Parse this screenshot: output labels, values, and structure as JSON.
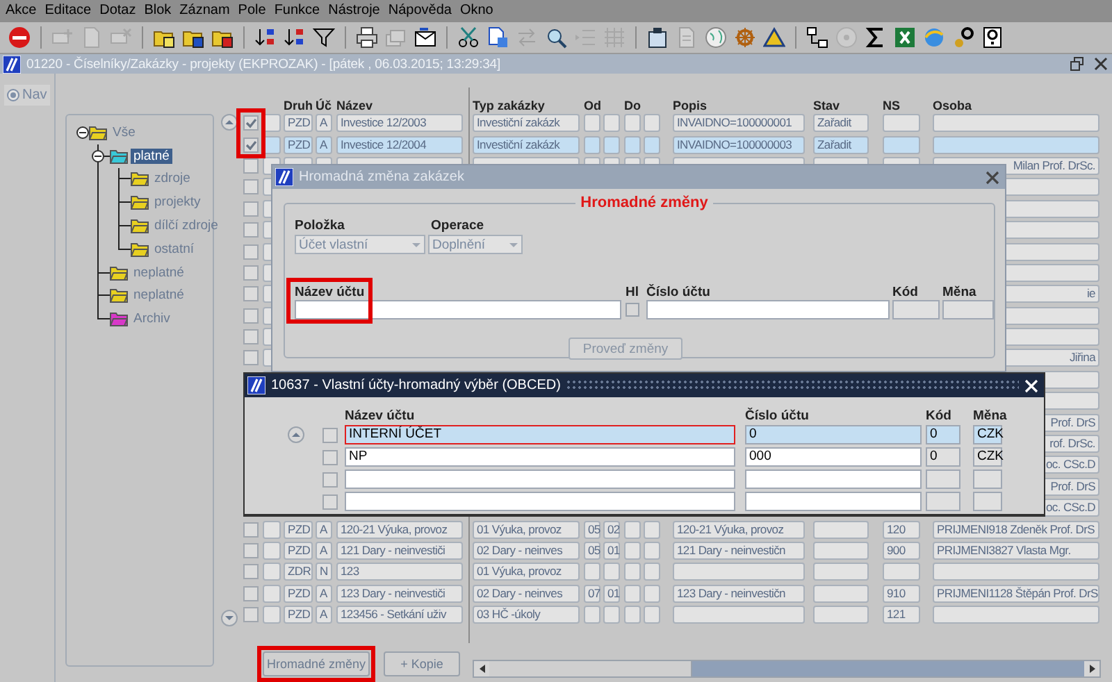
{
  "menu": [
    "Akce",
    "Editace",
    "Dotaz",
    "Blok",
    "Záznam",
    "Pole",
    "Funkce",
    "Nástroje",
    "Nápověda",
    "Okno"
  ],
  "toolbar": [
    {
      "disabled": false
    },
    {
      "disabled": true
    },
    {
      "disabled": true
    },
    {
      "disabled": true
    },
    {
      "disabled": false
    },
    {
      "disabled": false
    },
    {
      "disabled": false
    },
    {
      "disabled": false
    },
    {
      "disabled": false
    },
    {
      "disabled": false
    },
    {
      "disabled": false
    },
    {
      "disabled": true
    },
    {
      "disabled": false
    },
    {
      "disabled": false
    },
    {
      "disabled": false
    },
    {
      "disabled": true
    },
    {
      "disabled": false
    },
    {
      "disabled": true
    },
    {
      "disabled": true
    },
    {
      "disabled": false
    },
    {
      "disabled": true
    },
    {
      "disabled": false
    },
    {
      "disabled": false
    },
    {
      "disabled": false
    },
    {
      "disabled": false
    },
    {
      "disabled": true
    },
    {
      "disabled": false
    },
    {
      "disabled": false
    },
    {
      "disabled": false
    },
    {
      "disabled": false
    },
    {
      "disabled": false
    }
  ],
  "window": {
    "title": "01220 - Číselníky/Zakázky - projekty (EKPROZAK) - [pátek , 06.03.2015; 13:29:34]"
  },
  "nav": {
    "label": "Nav"
  },
  "tree": [
    {
      "label": "Vše",
      "expanded": true,
      "selected": false,
      "color": "#e8d020",
      "children": [
        {
          "label": "platné",
          "expanded": true,
          "selected": true,
          "color": "#38c8d8",
          "children": [
            {
              "label": "zdroje",
              "selected": false,
              "color": "#e8d020"
            },
            {
              "label": "projekty",
              "selected": false,
              "color": "#e8d020"
            },
            {
              "label": "dílčí zdroje",
              "selected": false,
              "color": "#e8d020"
            },
            {
              "label": "ostatní",
              "selected": false,
              "color": "#e8d020"
            }
          ]
        },
        {
          "label": "neplatné",
          "selected": false,
          "color": "#e8d020"
        },
        {
          "label": "neplatné",
          "selected": false,
          "color": "#e8d020"
        },
        {
          "label": "Archiv",
          "selected": false,
          "color": "#d838c8"
        }
      ]
    }
  ],
  "grid": {
    "columns": [
      "Druh",
      "Úč",
      "Název",
      "Typ zakázky",
      "Od",
      "Do",
      "Popis",
      "Stav",
      "NS",
      "Osoba"
    ],
    "rows": [
      {
        "kind": "full",
        "checked": true,
        "selected": false,
        "highlighted": true,
        "druh": "PZD",
        "uc": "A",
        "nazev": "Investice 12/2003",
        "typ": "Investiční zakázk",
        "popis": "INVAIDNO=100000001",
        "stav": "Zařadit"
      },
      {
        "kind": "full",
        "checked": true,
        "selected": true,
        "highlighted": true,
        "druh": "PZD",
        "uc": "A",
        "nazev": "Investice 12/2004",
        "typ": "Investiční zakázk",
        "popis": "INVAIDNO=100000003",
        "stav": "Zařadit"
      },
      {
        "kind": "tail",
        "checked": false,
        "osoba": "Milan Prof. DrSc."
      },
      {
        "kind": "tail",
        "checked": false
      },
      {
        "kind": "tail",
        "checked": false
      },
      {
        "kind": "tail",
        "checked": false
      },
      {
        "kind": "tail",
        "checked": false
      },
      {
        "kind": "tail",
        "checked": false
      },
      {
        "kind": "tail",
        "checked": false,
        "osoba": "ie"
      },
      {
        "kind": "tail",
        "checked": false
      },
      {
        "kind": "tail",
        "checked": false
      },
      {
        "kind": "tail",
        "checked": false,
        "osoba": "Jiřina"
      },
      {
        "kind": "tail"
      },
      {
        "kind": "tail"
      },
      {
        "kind": "tail",
        "osoba": "Prof. DrS"
      },
      {
        "kind": "tail",
        "osoba": "rof. DrSc."
      },
      {
        "kind": "tail",
        "osoba": "oc. CSc.D"
      },
      {
        "kind": "tail",
        "osoba": "Prof. DrS"
      },
      {
        "kind": "tail",
        "osoba": "oc. CSc.D"
      },
      {
        "kind": "full",
        "checked": false,
        "selected": false,
        "druh": "PZD",
        "uc": "A",
        "nazev": "120-21 Výuka, provoz",
        "typ": "01 Výuka, provoz",
        "od_1": "05",
        "od_2": "02",
        "popis": "120-21 Výuka, provoz",
        "ns": "120",
        "osoba": "PRIJMENI918 Zdeněk Prof. DrS"
      },
      {
        "kind": "full",
        "checked": false,
        "selected": false,
        "druh": "PZD",
        "uc": "A",
        "nazev": "121 Dary - neinvestiči",
        "typ": "02 Dary - neinves",
        "od_1": "05",
        "od_2": "01",
        "popis": "121 Dary - neinvestičn",
        "ns": "900",
        "osoba": "PRIJMENI3827 Vlasta Mgr."
      },
      {
        "kind": "full",
        "checked": false,
        "selected": false,
        "druh": "ZDR",
        "uc": "N",
        "nazev": "123",
        "typ": "01 Výuka, provoz"
      },
      {
        "kind": "full",
        "checked": false,
        "selected": false,
        "druh": "PZD",
        "uc": "A",
        "nazev": "123 Dary - neinvestiči",
        "typ": "02 Dary - neinves",
        "od_1": "07",
        "od_2": "01",
        "popis": "123 Dary - neinvestičn",
        "ns": "910",
        "osoba": "PRIJMENI1128 Štěpán Prof. DrS"
      },
      {
        "kind": "full",
        "checked": false,
        "selected": false,
        "druh": "PZD",
        "uc": "A",
        "nazev": "123456 - Setkání uživ",
        "typ": "03 HČ -úkoly",
        "ns": "121"
      }
    ]
  },
  "buttons": [
    {
      "label": "Hromadné změny",
      "highlighted": true
    },
    {
      "label": "+ Kopie"
    }
  ],
  "dialog_1": {
    "title": "Hromadná změna zakázek",
    "group": "Hromadné změny",
    "selects": [
      {
        "label": "Položka",
        "value": "Účet vlastní"
      },
      {
        "label": "Operace",
        "value": "Doplnění"
      }
    ],
    "columns": [
      {
        "label": "Název účtu",
        "highlighted": true
      },
      {
        "label": "Hl",
        "checked": false
      },
      {
        "label": "Číslo účtu"
      },
      {
        "label": "Kód"
      },
      {
        "label": "Měna"
      }
    ],
    "button": {
      "label": "Proveď změny",
      "disabled": true
    }
  },
  "dialog_2": {
    "title": "10637 - Vlastní účty-hromadný výběr (OBCED)",
    "columns": [
      "Název účtu",
      "Číslo účtu",
      "Kód",
      "Měna"
    ],
    "rows": [
      {
        "checked": false,
        "selected": true,
        "name": "INTERNÍ ÚČET",
        "number": "0",
        "code": "0",
        "currency": "CZK"
      },
      {
        "checked": false,
        "selected": false,
        "name": "NP",
        "number": "000",
        "code": "0",
        "currency": "CZK"
      },
      {
        "checked": false,
        "selected": false
      },
      {
        "checked": false,
        "selected": false
      }
    ]
  }
}
